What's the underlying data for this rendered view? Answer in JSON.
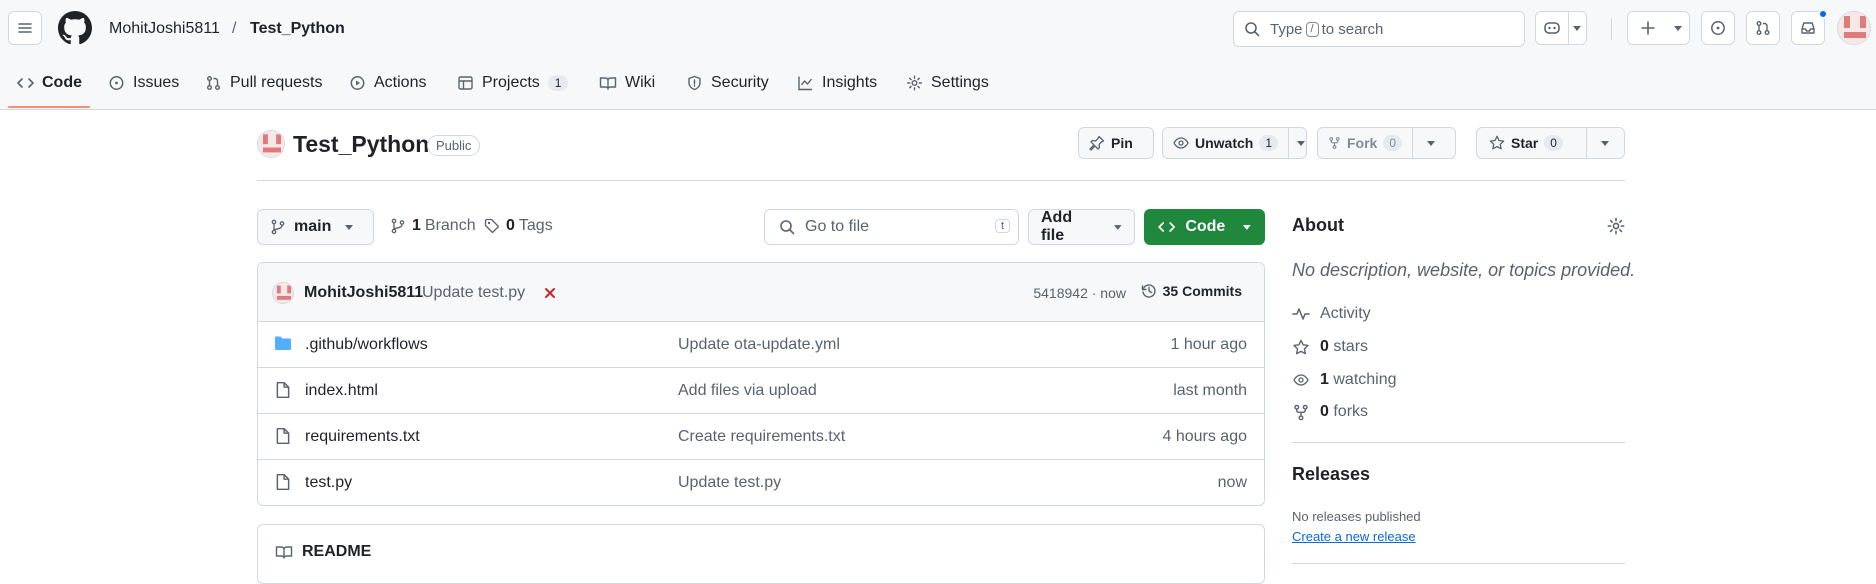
{
  "header": {
    "owner": "MohitJoshi5811",
    "separator": "/",
    "repo": "Test_Python",
    "search": {
      "prefix": "Type",
      "key": "/",
      "suffix": "to search"
    }
  },
  "tabs": [
    {
      "label": "Code"
    },
    {
      "label": "Issues"
    },
    {
      "label": "Pull requests"
    },
    {
      "label": "Actions"
    },
    {
      "label": "Projects",
      "count": "1"
    },
    {
      "label": "Wiki"
    },
    {
      "label": "Security"
    },
    {
      "label": "Insights"
    },
    {
      "label": "Settings"
    }
  ],
  "repo": {
    "title": "Test_Python",
    "visibility": "Public",
    "pin": "Pin",
    "unwatch": "Unwatch",
    "watch_count": "1",
    "fork": "Fork",
    "fork_count": "0",
    "star": "Star",
    "star_count": "0"
  },
  "toolbar": {
    "branch": "main",
    "branches_count": "1",
    "branches_label": "Branch",
    "tags_count": "0",
    "tags_label": "Tags",
    "goto_placeholder": "Go to file",
    "goto_key": "t",
    "add_file": "Add file",
    "code": "Code"
  },
  "commit": {
    "author": "MohitJoshi5811",
    "message": "Update test.py",
    "sha_time": "5418942 · now",
    "commits": "35 Commits"
  },
  "files": [
    {
      "name": ".github/workflows",
      "type": "folder",
      "message": "Update ota-update.yml",
      "age": "1 hour ago"
    },
    {
      "name": "index.html",
      "type": "file",
      "message": "Add files via upload",
      "age": "last month"
    },
    {
      "name": "requirements.txt",
      "type": "file",
      "message": "Create requirements.txt",
      "age": "4 hours ago"
    },
    {
      "name": "test.py",
      "type": "file",
      "message": "Update test.py",
      "age": "now"
    }
  ],
  "readme": {
    "label": "README"
  },
  "about": {
    "title": "About",
    "description": "No description, website, or topics provided.",
    "activity": "Activity",
    "stars_count": "0",
    "stars_label": "stars",
    "watching_count": "1",
    "watching_label": "watching",
    "forks_count": "0",
    "forks_label": "forks"
  },
  "releases": {
    "title": "Releases",
    "none": "No releases published",
    "create": "Create a new release"
  },
  "colors": {
    "accent_green": "#1f883d",
    "link_blue": "#0969da",
    "folder_blue": "#54aeff",
    "tab_underline": "#fd8c73",
    "fail_red": "#d1242f"
  }
}
